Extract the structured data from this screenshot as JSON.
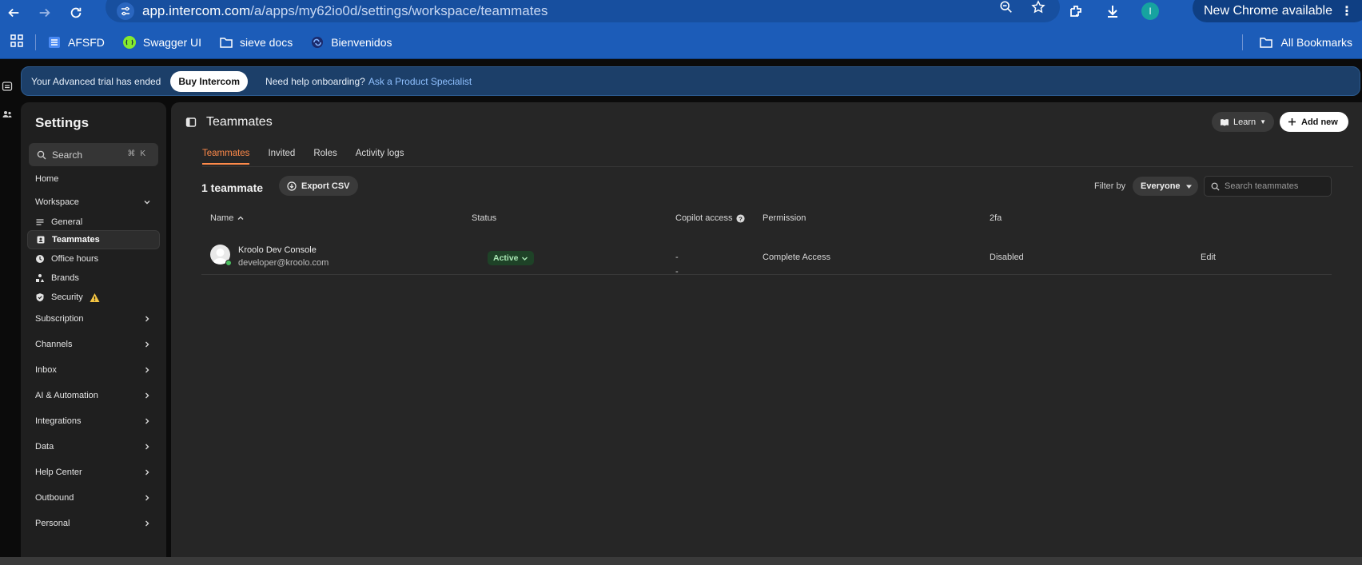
{
  "browser": {
    "url_host": "app.intercom.com",
    "url_path": "/a/apps/my62io0d/settings/workspace/teammates",
    "profile_initial": "I",
    "update_label": "New Chrome available"
  },
  "bookmarks": {
    "items": [
      {
        "label": "AFSFD",
        "icon": "doc-icon"
      },
      {
        "label": "Swagger UI",
        "icon": "swagger-icon"
      },
      {
        "label": "sieve docs",
        "icon": "folder-icon"
      },
      {
        "label": "Bienvenidos",
        "icon": "link-icon"
      }
    ],
    "all_label": "All Bookmarks"
  },
  "banner": {
    "trial_text": "Your Advanced trial has ended",
    "buy_label": "Buy Intercom",
    "help_text": "Need help onboarding?",
    "help_link": "Ask a Product Specialist"
  },
  "sidebar": {
    "title": "Settings",
    "search_label": "Search",
    "search_kbd": "⌘K",
    "home": "Home",
    "workspace": "Workspace",
    "workspace_items": {
      "general": "General",
      "teammates": "Teammates",
      "office_hours": "Office hours",
      "brands": "Brands",
      "security": "Security"
    },
    "sections": {
      "subscription": "Subscription",
      "channels": "Channels",
      "inbox": "Inbox",
      "ai": "AI & Automation",
      "integrations": "Integrations",
      "data": "Data",
      "help_center": "Help Center",
      "outbound": "Outbound",
      "personal": "Personal"
    }
  },
  "main": {
    "title": "Teammates",
    "learn_label": "Learn",
    "add_label": "Add new",
    "tabs": {
      "teammates": "Teammates",
      "invited": "Invited",
      "roles": "Roles",
      "activity": "Activity logs"
    },
    "count": "1 teammate",
    "export_label": "Export CSV",
    "filter_label": "Filter by",
    "filter_value": "Everyone",
    "search_placeholder": "Search teammates",
    "columns": {
      "name": "Name",
      "status": "Status",
      "copilot": "Copilot access",
      "permission": "Permission",
      "twofa": "2fa"
    },
    "row": {
      "name": "Kroolo Dev Console",
      "email": "developer@kroolo.com",
      "status": "Active",
      "copilot": "-",
      "permission": "Complete Access",
      "twofa": "Disabled",
      "edit": "Edit"
    },
    "trailing_dash": "-"
  },
  "colors": {
    "chrome_blue": "#1c5cb8",
    "banner_blue": "#1c3f69",
    "accent_orange": "#ff8a4a",
    "active_green": "#1e4227"
  }
}
